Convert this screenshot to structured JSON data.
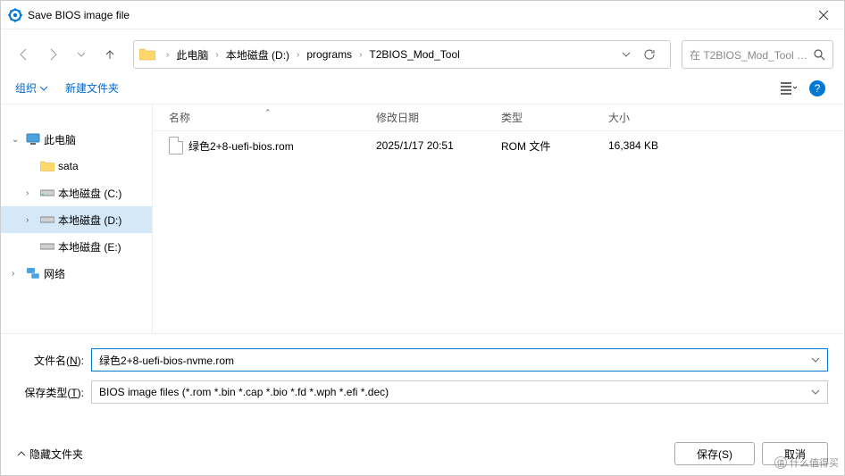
{
  "window": {
    "title": "Save BIOS image file"
  },
  "breadcrumbs": [
    "此电脑",
    "本地磁盘 (D:)",
    "programs",
    "T2BIOS_Mod_Tool"
  ],
  "search": {
    "placeholder": "在 T2BIOS_Mod_Tool 中..."
  },
  "toolbar": {
    "organize": "组织",
    "new_folder": "新建文件夹"
  },
  "tree": [
    {
      "label": "此电脑",
      "icon": "pc",
      "expanded": true,
      "level": 0
    },
    {
      "label": "sata",
      "icon": "folder",
      "level": 1
    },
    {
      "label": "本地磁盘 (C:)",
      "icon": "drive",
      "level": 1
    },
    {
      "label": "本地磁盘 (D:)",
      "icon": "drive",
      "level": 1,
      "selected": true
    },
    {
      "label": "本地磁盘 (E:)",
      "icon": "drive",
      "level": 1
    },
    {
      "label": "网络",
      "icon": "network",
      "level": 0
    }
  ],
  "columns": {
    "name": "名称",
    "date": "修改日期",
    "type": "类型",
    "size": "大小"
  },
  "files": [
    {
      "name": "绿色2+8-uefi-bios.rom",
      "date": "2025/1/17 20:51",
      "type": "ROM 文件",
      "size": "16,384 KB"
    }
  ],
  "filename_label": "文件名(N):",
  "filetype_label": "保存类型(T):",
  "filename_value": "绿色2+8-uefi-bios-nvme.rom",
  "filetype_value": "BIOS image files (*.rom *.bin *.cap *.bio *.fd *.wph *.efi *.dec)",
  "hide_folders": "隐藏文件夹",
  "buttons": {
    "save": "保存(S)",
    "cancel": "取消"
  },
  "watermark": "什么值得买"
}
